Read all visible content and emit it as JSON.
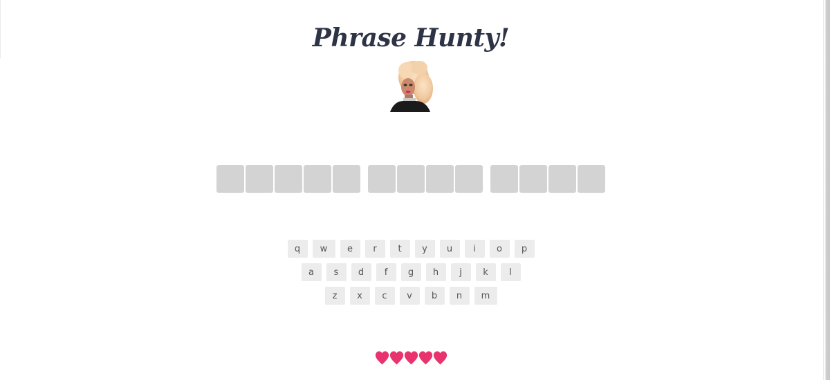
{
  "title": "Phrase Hunty!",
  "avatar_icon": "drag-queen-portrait",
  "phrase_words": [
    5,
    4,
    4
  ],
  "keyboard": {
    "rows": [
      [
        "q",
        "w",
        "e",
        "r",
        "t",
        "y",
        "u",
        "i",
        "o",
        "p"
      ],
      [
        "a",
        "s",
        "d",
        "f",
        "g",
        "h",
        "j",
        "k",
        "l"
      ],
      [
        "z",
        "x",
        "c",
        "v",
        "b",
        "n",
        "m"
      ]
    ]
  },
  "lives": 5,
  "colors": {
    "title": "#2e3446",
    "tile": "#d3d3d3",
    "key_bg": "#ececec",
    "heart": "#e8336f"
  }
}
